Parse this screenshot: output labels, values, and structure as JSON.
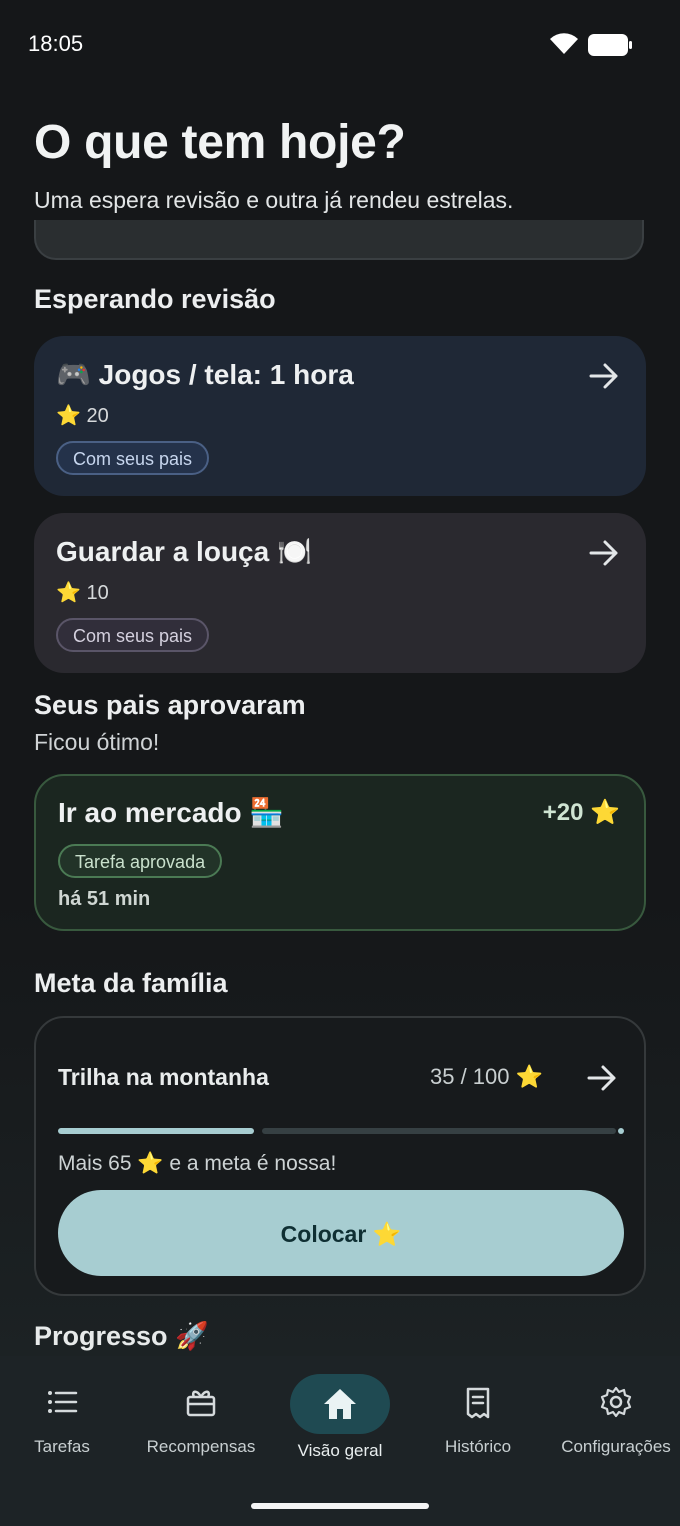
{
  "status_bar": {
    "time": "18:05"
  },
  "header": {
    "title": "O que tem hoje?",
    "subtitle": "Uma espera revisão e outra já rendeu estrelas."
  },
  "waiting_section": {
    "title": "Esperando revisão",
    "items": [
      {
        "title": "🎮 Jogos / tela: 1 hora",
        "stars": "⭐ 20",
        "chip": "Com seus pais"
      },
      {
        "title": "Guardar a louça 🍽️",
        "stars": "⭐ 10",
        "chip": "Com seus pais"
      }
    ]
  },
  "approved_section": {
    "title": "Seus pais aprovaram",
    "subtitle": "Ficou ótimo!",
    "item": {
      "title": "Ir ao mercado 🏪",
      "points": "+20 ⭐",
      "chip": "Tarefa aprovada",
      "time_ago": "há 51 min"
    }
  },
  "family_goal": {
    "title": "Meta da família",
    "goal_name": "Trilha na montanha",
    "progress_text": "35 / 100 ⭐",
    "progress_fraction": 0.35,
    "message": "Mais 65 ⭐ e a meta é nossa!",
    "button_label": "Colocar ⭐"
  },
  "next_section_peek": "Progresso 🚀",
  "bottom_nav": {
    "items": [
      {
        "label": "Tarefas",
        "icon": "list-icon",
        "active": false
      },
      {
        "label": "Recompensas",
        "icon": "gift-icon",
        "active": false
      },
      {
        "label": "Visão geral",
        "icon": "home-icon",
        "active": true
      },
      {
        "label": "Histórico",
        "icon": "receipt-icon",
        "active": false
      },
      {
        "label": "Configurações",
        "icon": "gear-icon",
        "active": false
      }
    ]
  },
  "colors": {
    "background": "#151719",
    "accent": "#a7cdd1",
    "nav_active": "#1f4a52",
    "approved_border": "#38593e"
  }
}
